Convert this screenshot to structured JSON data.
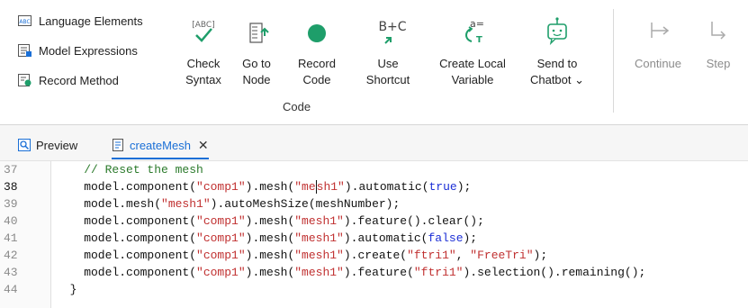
{
  "ribbon": {
    "left_items": [
      {
        "label": "Language Elements",
        "icon": "language-elements-icon"
      },
      {
        "label": "Model Expressions",
        "icon": "model-expressions-icon"
      },
      {
        "label": "Record Method",
        "icon": "record-method-icon"
      }
    ],
    "buttons": {
      "check_syntax": {
        "line1": "Check",
        "line2": "Syntax",
        "icon_text": "[ABC]"
      },
      "go_to_node": {
        "line1": "Go to",
        "line2": "Node"
      },
      "record_code": {
        "line1": "Record",
        "line2": "Code"
      },
      "use_shortcut": {
        "line1": "Use",
        "line2": "Shortcut",
        "icon_text": "B+C"
      },
      "create_local_variable": {
        "line1": "Create Local",
        "line2": "Variable",
        "icon_text": "a="
      },
      "send_to_chatbot": {
        "line1": "Send to",
        "line2": "Chatbot ⌄"
      },
      "continue": {
        "line1": "Continue"
      },
      "step": {
        "line1": "Step"
      }
    },
    "group_label": "Code",
    "colors": {
      "accent": "#1e9e6a",
      "blue": "#1a6fd6",
      "disabled": "#8c8c8c"
    }
  },
  "tabs": [
    {
      "label": "Preview",
      "active": false
    },
    {
      "label": "createMesh",
      "active": true,
      "close": "✕"
    }
  ],
  "editor": {
    "current_line": 38,
    "lines": [
      {
        "n": "37",
        "html": "    <span class='cmt'>// Reset the mesh</span>"
      },
      {
        "n": "38",
        "html": "    model.component(<span class='str'>\"comp1\"</span>).mesh(<span class='str'>\"me<span class='caret'></span>sh1\"</span>).automatic(<span class='kw'>true</span>);"
      },
      {
        "n": "39",
        "html": "    model.mesh(<span class='str'>\"mesh1\"</span>).autoMeshSize(meshNumber);"
      },
      {
        "n": "40",
        "html": "    model.component(<span class='str'>\"comp1\"</span>).mesh(<span class='str'>\"mesh1\"</span>).feature().clear();"
      },
      {
        "n": "41",
        "html": "    model.component(<span class='str'>\"comp1\"</span>).mesh(<span class='str'>\"mesh1\"</span>).automatic(<span class='kw'>false</span>);"
      },
      {
        "n": "42",
        "html": "    model.component(<span class='str'>\"comp1\"</span>).mesh(<span class='str'>\"mesh1\"</span>).create(<span class='str'>\"ftri1\"</span>, <span class='str'>\"FreeTri\"</span>);"
      },
      {
        "n": "43",
        "html": "    model.component(<span class='str'>\"comp1\"</span>).mesh(<span class='str'>\"mesh1\"</span>).feature(<span class='str'>\"ftri1\"</span>).selection().remaining();"
      },
      {
        "n": "44",
        "html": "  }"
      }
    ]
  }
}
